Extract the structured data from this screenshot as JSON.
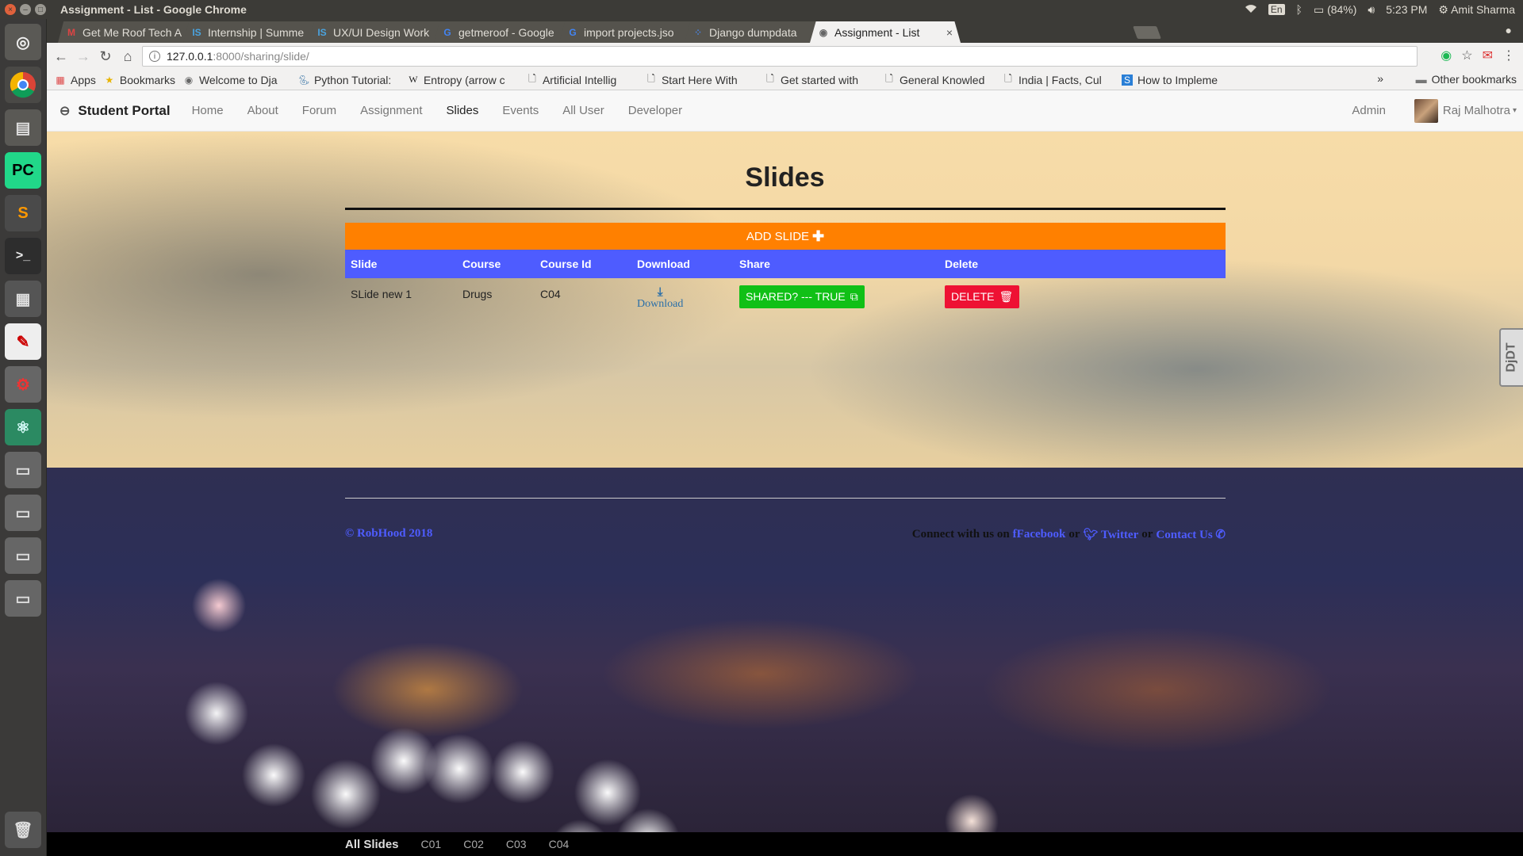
{
  "os": {
    "window_title": "Assignment - List - Google Chrome",
    "keyboard_lang": "En",
    "battery": "(84%)",
    "time": "5:23 PM",
    "user": "Amit Sharma"
  },
  "tabs": [
    {
      "label": "Get Me Roof Tech A",
      "icon": "gmail-icon"
    },
    {
      "label": "Internship | Summe",
      "icon": "internshala-icon"
    },
    {
      "label": "UX/UI Design Work",
      "icon": "internshala-icon"
    },
    {
      "label": "getmeroof - Google",
      "icon": "google-icon"
    },
    {
      "label": "import projects.jso",
      "icon": "google-icon"
    },
    {
      "label": "Django dumpdata",
      "icon": "docs-icon"
    },
    {
      "label": "Assignment - List",
      "icon": "page-icon",
      "active": true
    }
  ],
  "omnibox": {
    "host": "127.0.0.1",
    "path": ":8000/sharing/slide/"
  },
  "bookmarks": {
    "items": [
      {
        "label": "Apps",
        "icon": "apps-grid-icon"
      },
      {
        "label": "Bookmarks",
        "icon": "star-icon"
      },
      {
        "label": "Welcome to Dja",
        "icon": "globe-icon"
      },
      {
        "label": "Python Tutorial:",
        "icon": "python-icon"
      },
      {
        "label": "Entropy (arrow c",
        "icon": "wikipedia-icon"
      },
      {
        "label": "Artificial Intellig",
        "icon": "page-icon"
      },
      {
        "label": "Start Here With",
        "icon": "page-icon"
      },
      {
        "label": "Get started with",
        "icon": "page-icon"
      },
      {
        "label": "General Knowled",
        "icon": "page-icon"
      },
      {
        "label": "India | Facts, Cul",
        "icon": "page-icon"
      },
      {
        "label": "How to Impleme",
        "icon": "stack-icon"
      }
    ],
    "overflow": "»",
    "other": "Other bookmarks"
  },
  "navbar": {
    "brand": "Student Portal",
    "links": [
      "Home",
      "About",
      "Forum",
      "Assignment",
      "Slides",
      "Events",
      "All User",
      "Developer"
    ],
    "active": "Slides",
    "admin": "Admin",
    "profile_name": "Raj Malhotra"
  },
  "main": {
    "title": "Slides",
    "add_button": "ADD SLIDE",
    "columns": [
      "Slide",
      "Course",
      "Course Id",
      "Download",
      "Share",
      "Delete"
    ],
    "rows": [
      {
        "slide": "SLide new 1",
        "course": "Drugs",
        "course_id": "C04",
        "download": "Download",
        "share": "SHARED? --- TRUE",
        "delete": "DELETE"
      }
    ]
  },
  "debug_toolbar": "DjDT",
  "footer": {
    "copyright": "© RobHood 2018",
    "connect_prefix": "Connect with us on",
    "facebook": "Facebook",
    "or1": "or",
    "twitter": "Twitter",
    "or2": "or",
    "contact": "Contact Us"
  },
  "bottom_nav": [
    "All Slides",
    "C01",
    "C02",
    "C03",
    "C04"
  ],
  "colors": {
    "add_button": "#ff8000",
    "table_header": "#4e5cff",
    "share_button": "#10c016",
    "delete_button": "#ee1133",
    "link": "#4e5cff"
  }
}
